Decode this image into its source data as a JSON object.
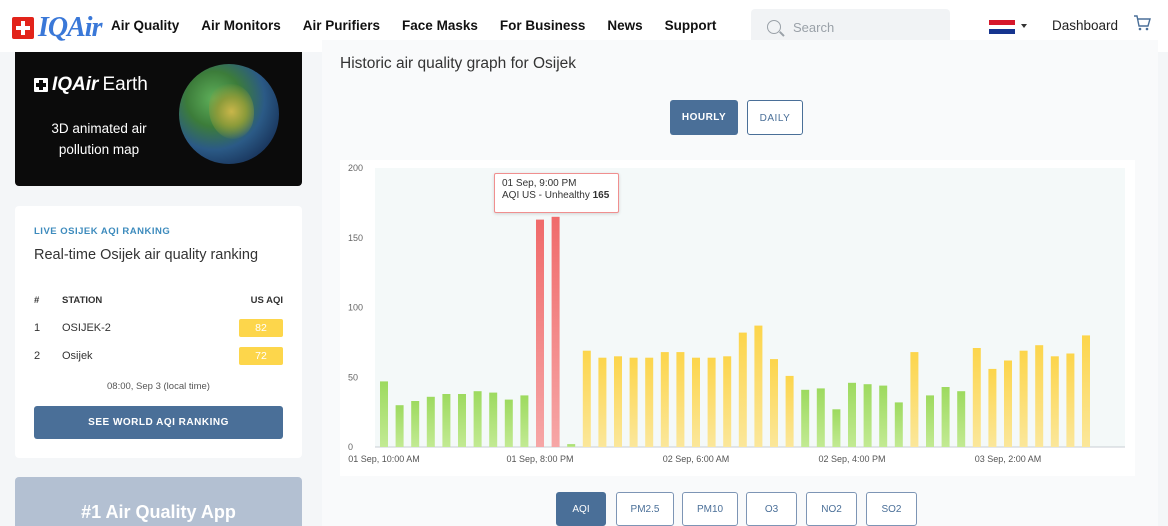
{
  "brand": {
    "name": "IQAir"
  },
  "nav": {
    "links": [
      "Air Quality",
      "Air Monitors",
      "Air Purifiers",
      "Face Masks",
      "For Business",
      "News",
      "Support"
    ],
    "search_placeholder": "Search",
    "dashboard": "Dashboard"
  },
  "earth_card": {
    "brand": "IQAir",
    "word": "Earth",
    "description": "3D animated air pollution map"
  },
  "ranking": {
    "kicker": "LIVE OSIJEK AQI RANKING",
    "title": "Real-time Osijek air quality ranking",
    "headers": {
      "num": "#",
      "station": "STATION",
      "aqi": "US AQI"
    },
    "rows": [
      {
        "num": "1",
        "station": "OSIJEK-2",
        "aqi": "82"
      },
      {
        "num": "2",
        "station": "Osijek",
        "aqi": "72"
      }
    ],
    "time": "08:00, Sep 3 (local time)",
    "button": "SEE WORLD AQI RANKING"
  },
  "app_card": {
    "title": "#1 Air Quality App"
  },
  "chart_section": {
    "heading": "Historic air quality graph for Osijek",
    "toggle": {
      "hourly": "HOURLY",
      "daily": "DAILY"
    },
    "tooltip": {
      "time": "01 Sep, 9:00 PM",
      "label": "AQI US - Unhealthy",
      "value": "165"
    },
    "pollutants": [
      "AQI",
      "PM2.5",
      "PM10",
      "O3",
      "NO2",
      "SO2"
    ]
  },
  "colors": {
    "accent": "#4a6f98",
    "good": "#a4e06b",
    "moderate": "#fcd54b",
    "unhealthy": "#f06b6b",
    "brand_red": "#e2231a",
    "brand_blue": "#3a78d8"
  },
  "chart_data": {
    "type": "bar",
    "title": "Historic air quality graph for Osijek",
    "ylim": [
      0,
      200
    ],
    "yticks": [
      0,
      50,
      100,
      150,
      200
    ],
    "xtick_labels": [
      "01 Sep, 10:00 AM",
      "01 Sep, 8:00 PM",
      "02 Sep, 6:00 AM",
      "02 Sep, 4:00 PM",
      "03 Sep, 2:00 AM"
    ],
    "xtick_index": [
      0,
      10,
      20,
      30,
      40
    ],
    "values": [
      47,
      30,
      33,
      36,
      38,
      38,
      40,
      39,
      34,
      37,
      163,
      165,
      2,
      69,
      64,
      65,
      64,
      64,
      68,
      68,
      64,
      64,
      65,
      82,
      87,
      63,
      51,
      41,
      42,
      27,
      46,
      45,
      44,
      32,
      68,
      37,
      43,
      40,
      71,
      56,
      62,
      69,
      73,
      65,
      67,
      80
    ],
    "highlight_index": 11
  }
}
